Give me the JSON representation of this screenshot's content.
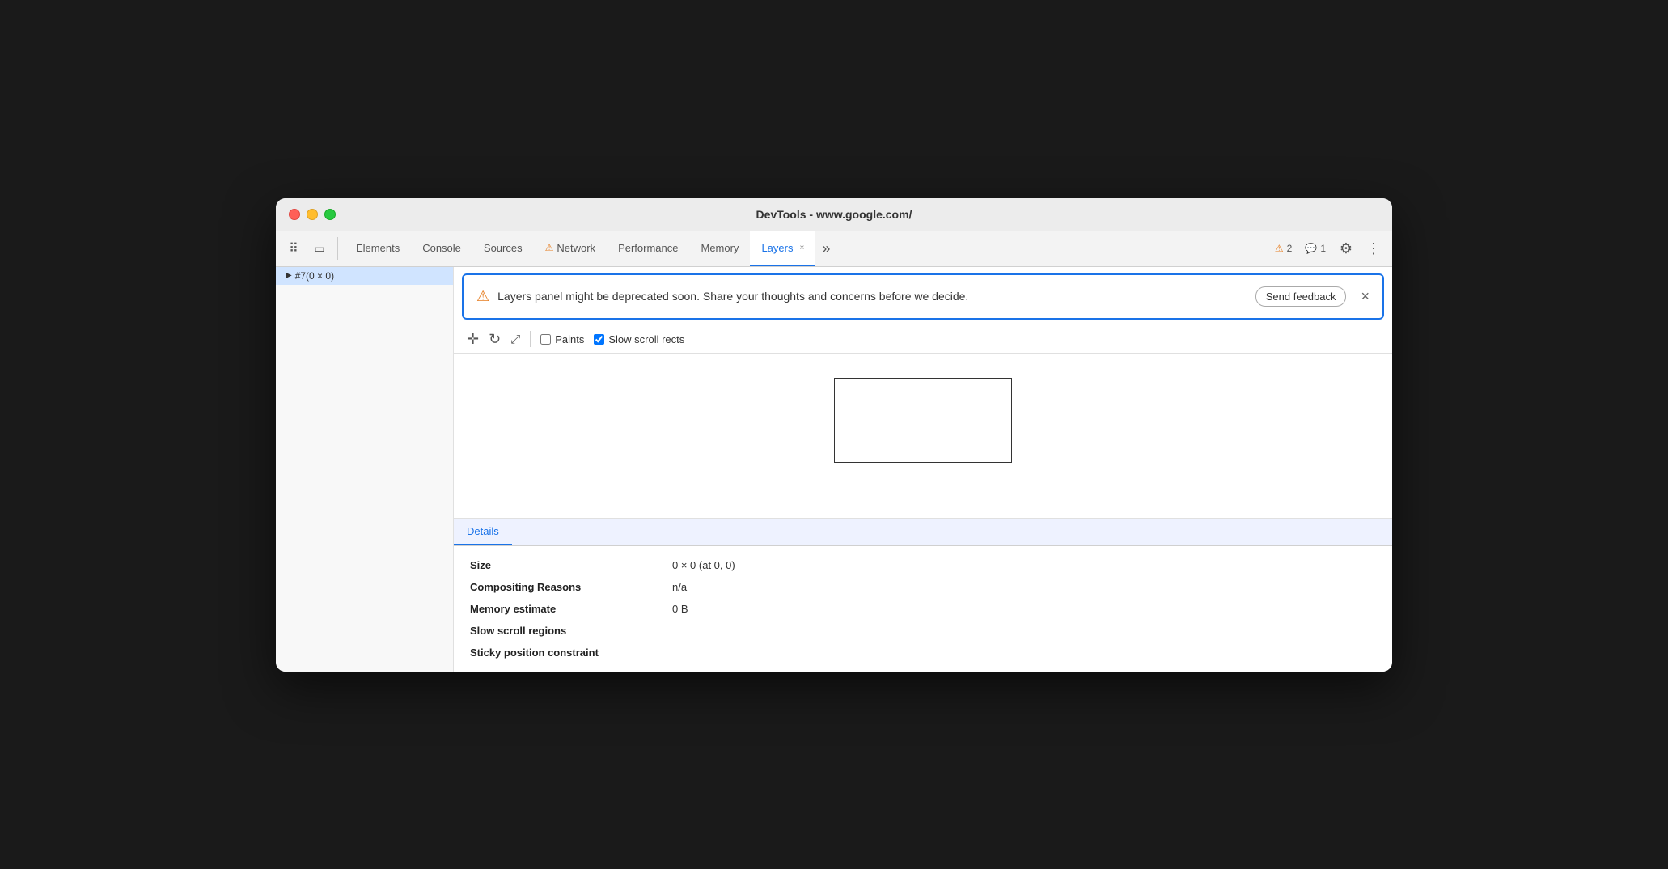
{
  "window": {
    "title": "DevTools - www.google.com/"
  },
  "tabs": {
    "icon_selector_label": "⠿",
    "icon_device_label": "▭",
    "items": [
      {
        "id": "elements",
        "label": "Elements",
        "active": false,
        "has_warning": false
      },
      {
        "id": "console",
        "label": "Console",
        "active": false,
        "has_warning": false
      },
      {
        "id": "sources",
        "label": "Sources",
        "active": false,
        "has_warning": false
      },
      {
        "id": "network",
        "label": "Network",
        "active": false,
        "has_warning": true
      },
      {
        "id": "performance",
        "label": "Performance",
        "active": false,
        "has_warning": false
      },
      {
        "id": "memory",
        "label": "Memory",
        "active": false,
        "has_warning": false
      },
      {
        "id": "layers",
        "label": "Layers",
        "active": true,
        "has_warning": false
      }
    ],
    "more_label": "»",
    "warning_count": "2",
    "info_count": "1"
  },
  "banner": {
    "message": "Layers panel might be deprecated soon. Share your thoughts and concerns before we decide.",
    "feedback_label": "Send feedback",
    "close_label": "×",
    "warn_icon": "⚠"
  },
  "toolbar": {
    "move_icon": "✛",
    "rotate_icon": "↻",
    "fit_icon": "⤢",
    "paints_label": "Paints",
    "slow_scroll_label": "Slow scroll rects",
    "paints_checked": false,
    "slow_scroll_checked": true
  },
  "sidebar": {
    "items": [
      {
        "label": "#7(0 × 0)",
        "selected": true
      }
    ]
  },
  "canvas": {
    "box_visible": true
  },
  "details": {
    "tab_label": "Details",
    "rows": [
      {
        "label": "Size",
        "value": "0 × 0 (at 0, 0)"
      },
      {
        "label": "Compositing Reasons",
        "value": "n/a"
      },
      {
        "label": "Memory estimate",
        "value": "0 B"
      },
      {
        "label": "Slow scroll regions",
        "value": ""
      },
      {
        "label": "Sticky position constraint",
        "value": ""
      }
    ]
  }
}
